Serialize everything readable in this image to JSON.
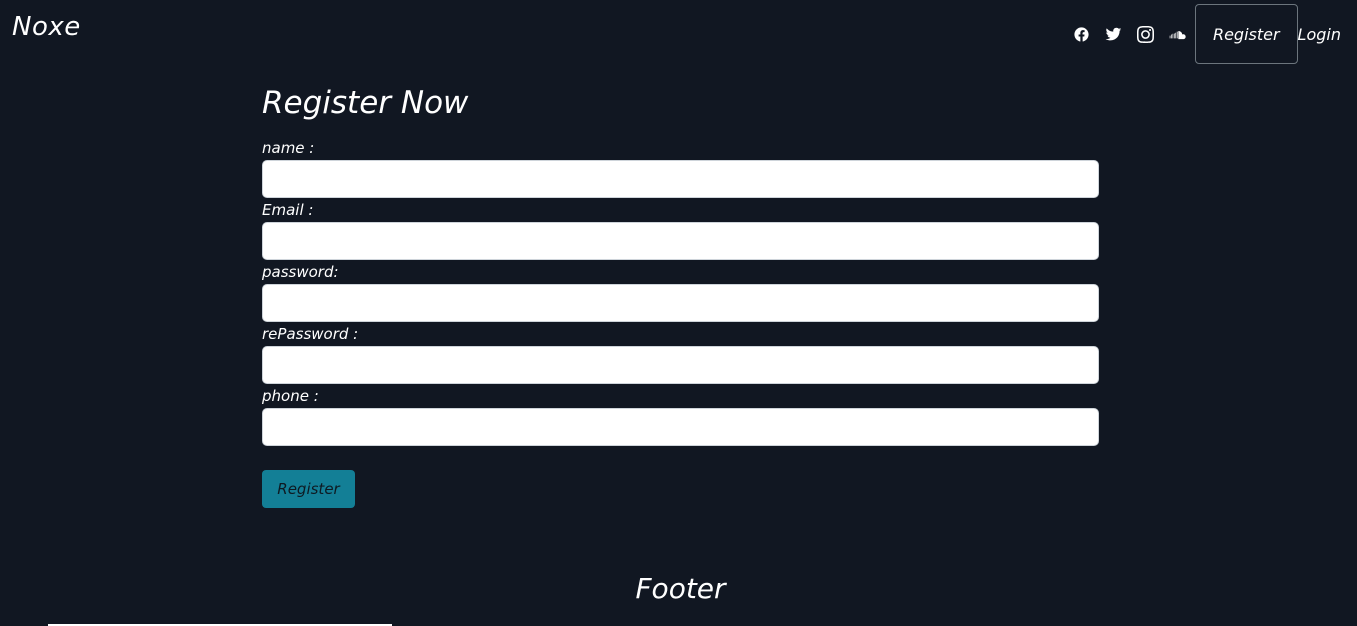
{
  "navbar": {
    "brand": "Noxe",
    "social_icons": [
      "facebook-icon",
      "twitter-icon",
      "instagram-icon",
      "soundcloud-icon"
    ],
    "links": [
      {
        "label": "Register",
        "active": true
      },
      {
        "label": "Login",
        "active": false
      }
    ]
  },
  "form": {
    "title": "Register Now",
    "fields": [
      {
        "label": "name :",
        "value": ""
      },
      {
        "label": "Email :",
        "value": ""
      },
      {
        "label": "password:",
        "value": ""
      },
      {
        "label": "rePassword :",
        "value": ""
      },
      {
        "label": "phone :",
        "value": ""
      }
    ],
    "submit_label": "Register"
  },
  "footer": {
    "title": "Footer"
  },
  "colors": {
    "background": "#111722",
    "button": "#137f96"
  }
}
